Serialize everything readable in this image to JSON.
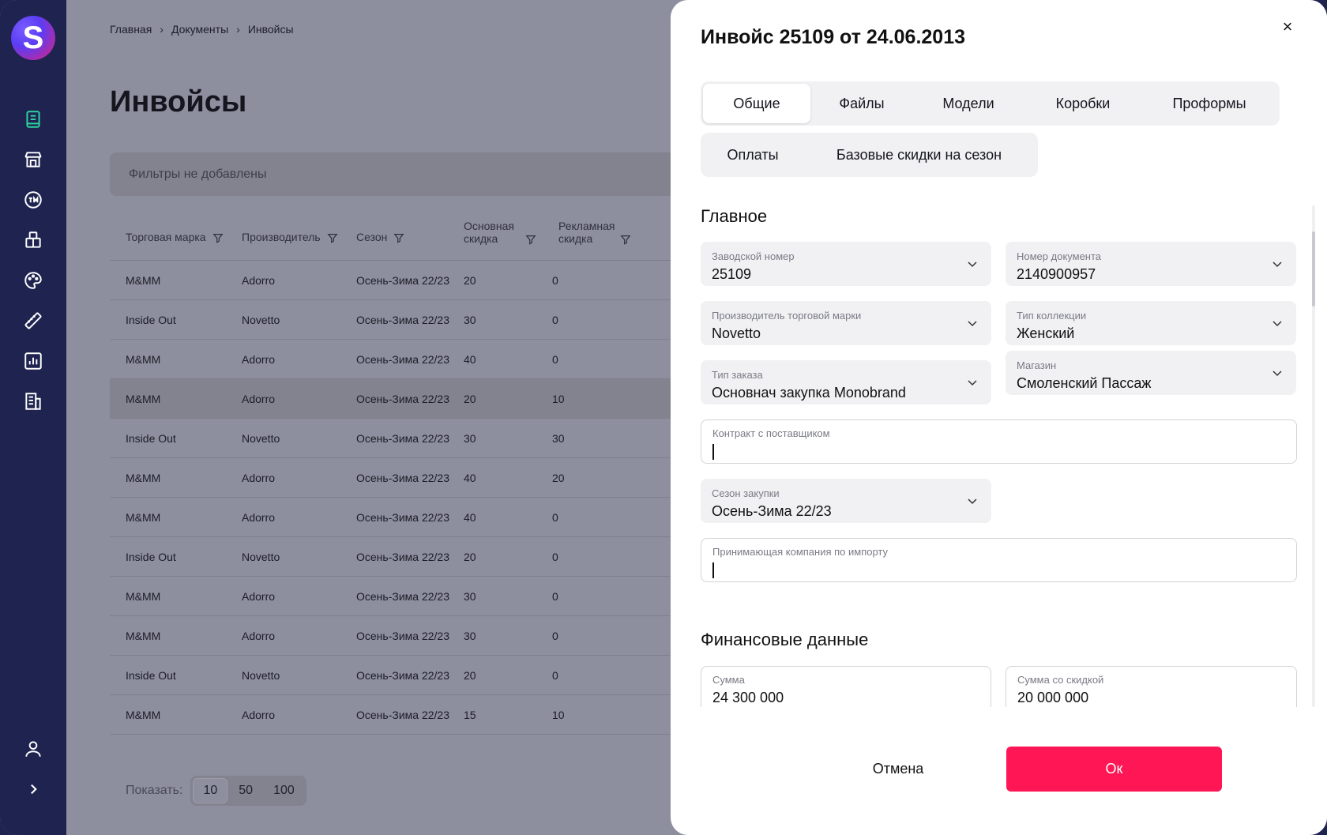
{
  "brand": {
    "logo_letter": "S",
    "accent": "#ff1654",
    "sidebar_bg": "#1e2350",
    "active_icon": "#2ed3a0"
  },
  "sidebar": {
    "items": [
      {
        "icon": "book-icon",
        "active": true
      },
      {
        "icon": "store-icon"
      },
      {
        "icon": "trademark-icon"
      },
      {
        "icon": "boxes-icon"
      },
      {
        "icon": "palette-icon"
      },
      {
        "icon": "ruler-icon"
      },
      {
        "icon": "chart-icon"
      },
      {
        "icon": "building-icon"
      }
    ],
    "bottom": [
      {
        "icon": "user-icon"
      },
      {
        "icon": "chevron-right-icon"
      }
    ]
  },
  "breadcrumb": {
    "items": [
      "Главная",
      "Документы",
      "Инвойсы"
    ]
  },
  "page": {
    "title": "Инвойсы",
    "filter_placeholder": "Фильтры не добавлены"
  },
  "table": {
    "headers": [
      "Торговая марка",
      "Производитель",
      "Сезон",
      "Основная скидка",
      "Рекламная скидка"
    ],
    "header_lines": {
      "main_discount": [
        "Основная",
        "скидка"
      ],
      "ad_discount": [
        "Рекламная",
        "скидка"
      ]
    },
    "rows": [
      [
        "M&MM",
        "Adorro",
        "Осень-Зима 22/23",
        "20",
        "0"
      ],
      [
        "Inside Out",
        "Novetto",
        "Осень-Зима 22/23",
        "30",
        "0"
      ],
      [
        "M&MM",
        "Adorro",
        "Осень-Зима 22/23",
        "40",
        "0"
      ],
      [
        "M&MM",
        "Adorro",
        "Осень-Зима 22/23",
        "20",
        "10"
      ],
      [
        "Inside Out",
        "Novetto",
        "Осень-Зима 22/23",
        "30",
        "30"
      ],
      [
        "M&MM",
        "Adorro",
        "Осень-Зима 22/23",
        "40",
        "20"
      ],
      [
        "M&MM",
        "Adorro",
        "Осень-Зима 22/23",
        "40",
        "0"
      ],
      [
        "Inside Out",
        "Novetto",
        "Осень-Зима 22/23",
        "20",
        "0"
      ],
      [
        "M&MM",
        "Adorro",
        "Осень-Зима 22/23",
        "30",
        "0"
      ],
      [
        "M&MM",
        "Adorro",
        "Осень-Зима 22/23",
        "30",
        "0"
      ],
      [
        "Inside Out",
        "Novetto",
        "Осень-Зима 22/23",
        "20",
        "0"
      ],
      [
        "M&MM",
        "Adorro",
        "Осень-Зима 22/23",
        "15",
        "10"
      ]
    ]
  },
  "pager": {
    "label": "Показать:",
    "options": [
      "10",
      "50",
      "100"
    ],
    "selected": "10"
  },
  "modal": {
    "title": "Инвойс 25109 от 24.06.2013",
    "close_symbol": "×",
    "tabs_row1": [
      "Общие",
      "Файлы",
      "Модели",
      "Коробки",
      "Проформы"
    ],
    "tabs_row2": [
      "Оплаты",
      "Базовые скидки на сезон"
    ],
    "active_tab": "Общие",
    "section_main": "Главное",
    "section_finance": "Финансовые данные",
    "fields": {
      "factory_number": {
        "label": "Заводской номер",
        "value": "25109"
      },
      "document_number": {
        "label": "Номер документа",
        "value": "2140900957"
      },
      "brand_manufacturer": {
        "label": "Производитель торговой марки",
        "value": "Novetto"
      },
      "collection_type": {
        "label": "Тип коллекции",
        "value": "Женский"
      },
      "order_type": {
        "label": "Тип заказа",
        "value": "Основнач закупка Monobrand"
      },
      "store": {
        "label": "Магазин",
        "value": "Смоленский Пассаж"
      },
      "contract": {
        "label": "Контракт с поставщиком",
        "value": ""
      },
      "purchase_season": {
        "label": "Сезон закупки",
        "value": "Осень-Зима 22/23"
      },
      "import_company": {
        "label": "Принимающая компания по импорту",
        "value": ""
      },
      "amount": {
        "label": "Сумма",
        "value": "24 300 000"
      },
      "discounted_amount": {
        "label": "Сумма со скидкой",
        "value": "20 000 000"
      }
    },
    "buttons": {
      "cancel": "Отмена",
      "ok": "Ок"
    }
  }
}
